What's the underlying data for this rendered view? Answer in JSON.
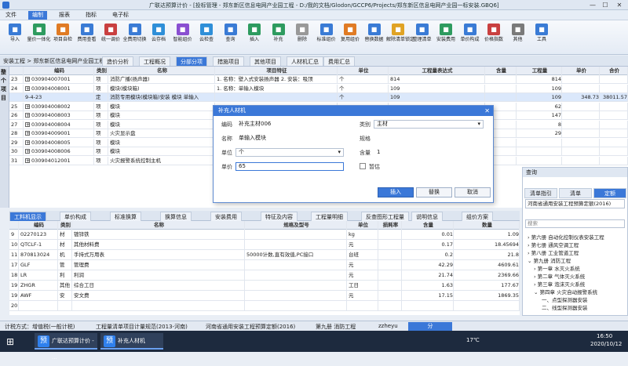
{
  "window": {
    "title": "广联达预算计价 - [投标管理 - 郑东新区信息电网产业园工程 - D:/我的文档/Glodon/GCCP6/Projects/郑东新区信息电网产业园一标安装.GBQ6]"
  },
  "menu": [
    "文件",
    "编制",
    "报表",
    "指标",
    "电子标"
  ],
  "menu_active": 1,
  "ribbon": [
    {
      "label": "导入",
      "icon": "import-icon",
      "color": "#3a7bd5"
    },
    {
      "label": "量价一体化",
      "icon": "link-icon",
      "color": "#2e9b5f"
    },
    {
      "label": "项目自检",
      "icon": "check-icon",
      "color": "#e07b24"
    },
    {
      "label": "费用查看",
      "icon": "eye-icon",
      "color": "#3a7bd5"
    },
    {
      "label": "统一调价",
      "icon": "price-icon",
      "color": "#c94040"
    },
    {
      "label": "全费用切换",
      "icon": "switch-icon",
      "color": "#3a7bd5"
    },
    {
      "label": "云存档",
      "icon": "cloud-icon",
      "color": "#2f8fd8"
    },
    {
      "label": "智能组价",
      "icon": "smart-icon",
      "color": "#8a4fd1"
    },
    {
      "label": "云检查",
      "icon": "cloud-check-icon",
      "color": "#2f8fd8"
    },
    {
      "label": "查询",
      "icon": "search-icon",
      "color": "#3a7bd5"
    },
    {
      "label": "插入",
      "icon": "insert-icon",
      "color": "#2e9b5f"
    },
    {
      "label": "补充",
      "icon": "add-icon",
      "color": "#2e9b5f"
    },
    {
      "label": "删除",
      "icon": "delete-icon",
      "color": "#999999"
    },
    {
      "label": "标准组价",
      "icon": "standard-icon",
      "color": "#3a7bd5"
    },
    {
      "label": "复用组价",
      "icon": "reuse-icon",
      "color": "#e07b24"
    },
    {
      "label": "替换数据",
      "icon": "replace-icon",
      "color": "#3a7bd5"
    },
    {
      "label": "解除清单锁定",
      "icon": "unlock-icon",
      "color": "#e0a324"
    },
    {
      "label": "整理清单",
      "icon": "list-icon",
      "color": "#3a7bd5"
    },
    {
      "label": "安装费用",
      "icon": "install-icon",
      "color": "#2e9b5f"
    },
    {
      "label": "单价构成",
      "icon": "structure-icon",
      "color": "#3a7bd5"
    },
    {
      "label": "价格指数",
      "icon": "index-icon",
      "color": "#c94040"
    },
    {
      "label": "其他",
      "icon": "more-icon",
      "color": "#7a7a7a"
    },
    {
      "label": "工具",
      "icon": "tool-icon",
      "color": "#3a7bd5"
    }
  ],
  "project_tree": {
    "breadcrumb": "安装工程  > 郑东新区信息电网产业园工程"
  },
  "tabs": [
    "造价分析",
    "工程概况",
    "分部分项",
    "措施项目",
    "其他项目",
    "人材机汇总",
    "费用汇总"
  ],
  "tabs_active": 2,
  "leftbar_text": "整个项目",
  "grid": {
    "columns": [
      "编码",
      "类别",
      "名称",
      "项目特征",
      "单位",
      "工程量表达式",
      "含量",
      "工程量",
      "单价",
      "合价"
    ],
    "rows": [
      {
        "no": "23",
        "code": "030904007001",
        "type": "项",
        "name": "消防广播(扬声器)",
        "feature": "1. 名称：壁入式安装扬声器  2. 安装：吸顶",
        "unit": "个",
        "expr": "814",
        "content": "",
        "qty": "814",
        "price": "",
        "total": ""
      },
      {
        "no": "24",
        "code": "030904008001",
        "type": "项",
        "name": "模块(模块箱)",
        "feature": "1. 名称：单输入模块",
        "unit": "个",
        "expr": "109",
        "content": "",
        "qty": "109",
        "price": "",
        "total": ""
      },
      {
        "no": "",
        "code": "9-4-23",
        "type": "定",
        "name": "消防专用模块(模块箱)安装 模块 单输入",
        "feature": "",
        "unit": "个",
        "expr": "109",
        "content": "",
        "qty": "109",
        "price": "348.73",
        "total": "38011.57"
      },
      {
        "no": "25",
        "code": "030904008002",
        "type": "项",
        "name": "模块",
        "feature": "",
        "unit": "",
        "expr": "",
        "content": "",
        "qty": "62",
        "price": "",
        "total": ""
      },
      {
        "no": "26",
        "code": "030904008003",
        "type": "项",
        "name": "模块",
        "feature": "",
        "unit": "",
        "expr": "",
        "content": "",
        "qty": "147",
        "price": "",
        "total": ""
      },
      {
        "no": "27",
        "code": "030904008004",
        "type": "项",
        "name": "模块",
        "feature": "",
        "unit": "",
        "expr": "",
        "content": "",
        "qty": "8",
        "price": "",
        "total": ""
      },
      {
        "no": "28",
        "code": "030904009001",
        "type": "项",
        "name": "火灾显示盘",
        "feature": "",
        "unit": "",
        "expr": "",
        "content": "",
        "qty": "29",
        "price": "",
        "total": ""
      },
      {
        "no": "29",
        "code": "030904008005",
        "type": "项",
        "name": "模块",
        "feature": "",
        "unit": "",
        "expr": "",
        "content": "",
        "qty": "",
        "price": "",
        "total": ""
      },
      {
        "no": "30",
        "code": "030904008006",
        "type": "项",
        "name": "模块",
        "feature": "",
        "unit": "",
        "expr": "",
        "content": "",
        "qty": "",
        "price": "",
        "total": ""
      },
      {
        "no": "31",
        "code": "030904012001",
        "type": "项",
        "name": "火灾报警系统控制主机",
        "feature": "",
        "unit": "",
        "expr": "",
        "content": "",
        "qty": "",
        "price": "",
        "total": ""
      }
    ]
  },
  "dialog": {
    "title": "补充人材机",
    "code_label": "编码",
    "code_value": "补充主材006",
    "category_label": "类别",
    "category_value": "主材",
    "name_label": "名称",
    "name_value": "单输入模块",
    "spec_label": "规格",
    "spec_value": "",
    "unit_label": "单位",
    "unit_value": "个",
    "content_label": "含量",
    "content_value": "1",
    "price_label": "单价",
    "price_value": "65",
    "temp_label": "暂估",
    "insert": "插入",
    "replace": "替换",
    "cancel": "取消"
  },
  "bottom_tabs": [
    "工料机显示",
    "单价构成",
    "标准换算",
    "换算信息",
    "安装费用",
    "特征及内容",
    "工程量明细",
    "反查图形工程量",
    "说明信息",
    "组价方案"
  ],
  "bottom_tabs_active": 0,
  "bottom_grid": {
    "columns": [
      "编码",
      "类别",
      "名称",
      "规格及型号",
      "单位",
      "损耗率",
      "含量",
      "数量"
    ],
    "rows": [
      {
        "no": "9",
        "code": "02270123",
        "type": "材",
        "name": "镀锌铁",
        "spec": "",
        "unit": "kg",
        "loss": "",
        "content": "0.01",
        "qty": "1.09"
      },
      {
        "no": "10",
        "code": "QTCLF-1",
        "type": "材",
        "name": "其他材料费",
        "spec": "",
        "unit": "元",
        "loss": "",
        "content": "0.17",
        "qty": "18.45694"
      },
      {
        "no": "11",
        "code": "870813024",
        "type": "机",
        "name": "手持式万用表",
        "spec": "50000计数,直有效值,PC接口",
        "unit": "台班",
        "loss": "",
        "content": "0.2",
        "qty": "21.8"
      },
      {
        "no": "17",
        "code": "GLF",
        "type": "管",
        "name": "管理费",
        "spec": "",
        "unit": "元",
        "loss": "",
        "content": "42.29",
        "qty": "4609.61"
      },
      {
        "no": "18",
        "code": "LR",
        "type": "利",
        "name": "利润",
        "spec": "",
        "unit": "元",
        "loss": "",
        "content": "21.74",
        "qty": "2369.66"
      },
      {
        "no": "19",
        "code": "ZHGR",
        "type": "其他",
        "name": "综合工日",
        "spec": "",
        "unit": "工日",
        "loss": "",
        "content": "1.63",
        "qty": "177.67"
      },
      {
        "no": "19",
        "code": "AWF",
        "type": "安",
        "name": "安文费",
        "spec": "",
        "unit": "元",
        "loss": "",
        "content": "17.15",
        "qty": "1869.35"
      },
      {
        "no": "20",
        "code": "",
        "type": "",
        "name": "",
        "spec": "",
        "unit": "",
        "loss": "",
        "content": "",
        "qty": ""
      }
    ]
  },
  "side": {
    "title": "查询",
    "tabs": [
      "清单指引",
      "清单",
      "定额"
    ],
    "tabs_active": 2,
    "book": "河南省通用安装工程预算定额(2016)",
    "tree": [
      "第六册 自动化控制仪表安装工程",
      "第七册 通风空调工程",
      "第八册 工业管道工程",
      "第九册 消防工程",
      "第一章 水灭火系统",
      "第二章 气体灭火系统",
      "第三章 泡沫灭火系统",
      "第四章 火灾自动报警系统",
      "一、点型探测器安装",
      "二、线型探测器安装"
    ],
    "search_placeholder": "搜索"
  },
  "status": {
    "tax": "计税方式：增值税(一般计税)",
    "rule": "工程量清单项目计量规范(2013-河南)",
    "quota": "河南省通用安装工程预算定额(2016)",
    "book": "第九册 消防工程",
    "user": "zzheyu",
    "zoom_btn": "分"
  },
  "taskbar": {
    "app1": "广联达预算计价 - ...",
    "app2": "补充人材机",
    "temp": "17℃",
    "time": "16:50",
    "date": "2020/10/12"
  }
}
